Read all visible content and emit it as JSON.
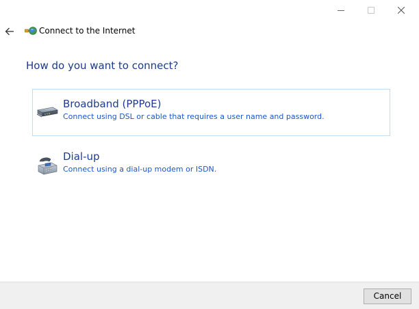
{
  "window": {
    "title": "Connect to the Internet",
    "caption_buttons": [
      "minimize",
      "maximize",
      "close"
    ]
  },
  "navigation": {
    "back_icon": "arrow-left-icon",
    "app_icon": "network-globe-icon"
  },
  "main": {
    "heading": "How do you want to connect?",
    "options": [
      {
        "title": "Broadband (PPPoE)",
        "description": "Connect using DSL or cable that requires a user name and password.",
        "icon": "broadband-modem-icon",
        "selected": true
      },
      {
        "title": "Dial-up",
        "description": "Connect using a dial-up modem or ISDN.",
        "icon": "telephone-modem-icon",
        "selected": false
      }
    ]
  },
  "footer": {
    "cancel_label": "Cancel"
  },
  "colors": {
    "heading": "#1b3a8a",
    "option_title": "#1e3c94",
    "option_desc": "#1e56c6",
    "selected_border": "#c4dcef",
    "footer_bg": "#f0f0f0"
  }
}
